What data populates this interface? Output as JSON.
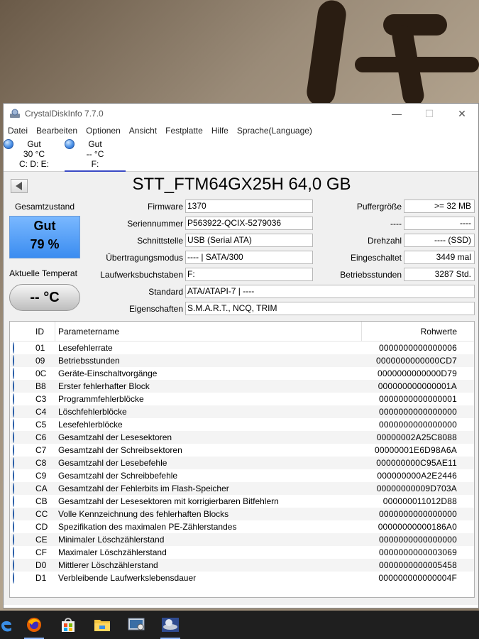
{
  "window": {
    "title": "CrystalDiskInfo 7.7.0",
    "minimize": "—",
    "maximize": "☐",
    "close": "✕"
  },
  "menu": [
    "Datei",
    "Bearbeiten",
    "Optionen",
    "Ansicht",
    "Festplatte",
    "Hilfe",
    "Sprache(Language)"
  ],
  "disks": [
    {
      "status": "Gut",
      "temp": "30 °C",
      "letters": "C: D: E:"
    },
    {
      "status": "Gut",
      "temp": "-- °C",
      "letters": "F:"
    }
  ],
  "drive": {
    "model": "STT_FTM64GX25H 64,0 GB",
    "health_label": "Gesamtzustand",
    "health_status": "Gut",
    "health_percent": "79 %",
    "temp_label": "Aktuelle Temperat",
    "temp_value": "-- °C",
    "firmware_label": "Firmware",
    "firmware": "1370",
    "serial_label": "Seriennummer",
    "serial": "P563922-QCIX-5279036",
    "interface_label": "Schnittstelle",
    "interface": "USB (Serial ATA)",
    "transfer_label": "Übertragungsmodus",
    "transfer": "---- | SATA/300",
    "letters_label": "Laufwerksbuchstaben",
    "letters": "F:",
    "standard_label": "Standard",
    "standard": "ATA/ATAPI-7 | ----",
    "features_label": "Eigenschaften",
    "features": "S.M.A.R.T., NCQ, TRIM",
    "buffer_label": "Puffergröße",
    "buffer": ">= 32 MB",
    "blank_label": "----",
    "blank_value": "----",
    "rpm_label": "Drehzahl",
    "rpm": "---- (SSD)",
    "power_on_count_label": "Eingeschaltet",
    "power_on_count": "3449 mal",
    "power_on_hours_label": "Betriebsstunden",
    "power_on_hours": "3287 Std."
  },
  "smart": {
    "headers": {
      "id": "ID",
      "name": "Parametername",
      "raw": "Rohwerte"
    },
    "rows": [
      {
        "id": "01",
        "name": "Lesefehlerrate",
        "raw": "0000000000000006"
      },
      {
        "id": "09",
        "name": "Betriebsstunden",
        "raw": "0000000000000CD7"
      },
      {
        "id": "0C",
        "name": "Geräte-Einschaltvorgänge",
        "raw": "0000000000000D79"
      },
      {
        "id": "B8",
        "name": "Erster fehlerhafter Block",
        "raw": "000000000000001A"
      },
      {
        "id": "C3",
        "name": "Programmfehlerblöcke",
        "raw": "0000000000000001"
      },
      {
        "id": "C4",
        "name": "Löschfehlerblöcke",
        "raw": "0000000000000000"
      },
      {
        "id": "C5",
        "name": "Lesefehlerblöcke",
        "raw": "0000000000000000"
      },
      {
        "id": "C6",
        "name": "Gesamtzahl der Lesesektoren",
        "raw": "00000002A25C8088"
      },
      {
        "id": "C7",
        "name": "Gesamtzahl der Schreibsektoren",
        "raw": "00000001E6D98A6A"
      },
      {
        "id": "C8",
        "name": "Gesamtzahl der Lesebefehle",
        "raw": "000000000C95AE11"
      },
      {
        "id": "C9",
        "name": "Gesamtzahl der Schreibbefehle",
        "raw": "000000000A2E2446"
      },
      {
        "id": "CA",
        "name": "Gesamtzahl der Fehlerbits im Flash-Speicher",
        "raw": "00000000009D703A"
      },
      {
        "id": "CB",
        "name": "Gesamtzahl der Lesesektoren mit korrigierbaren Bitfehlern",
        "raw": "000000011012D88"
      },
      {
        "id": "CC",
        "name": "Volle Kennzeichnung des fehlerhaften Blocks",
        "raw": "0000000000000000"
      },
      {
        "id": "CD",
        "name": "Spezifikation des maximalen PE-Zählerstandes",
        "raw": "00000000000186A0"
      },
      {
        "id": "CE",
        "name": "Minimaler Löschzählerstand",
        "raw": "0000000000000000"
      },
      {
        "id": "CF",
        "name": "Maximaler Löschzählerstand",
        "raw": "0000000000003069"
      },
      {
        "id": "D0",
        "name": "Mittlerer Löschzählerstand",
        "raw": "0000000000005458"
      },
      {
        "id": "D1",
        "name": "Verbleibende Laufwerkslebensdauer",
        "raw": "000000000000004F"
      }
    ]
  },
  "taskbar": [
    "edge-icon",
    "firefox-icon",
    "store-icon",
    "explorer-icon",
    "control-panel-icon",
    "crystaldiskinfo-icon"
  ]
}
